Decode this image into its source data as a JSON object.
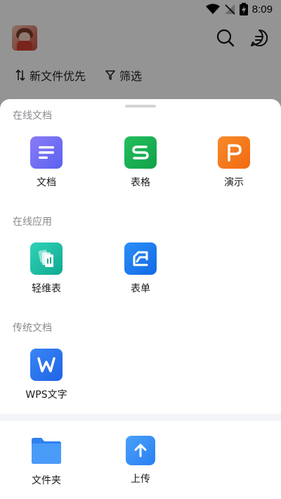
{
  "status_bar": {
    "time": "8:09"
  },
  "header": {
    "sort_label": "新文件优先",
    "filter_label": "筛选"
  },
  "sheet": {
    "sections": [
      {
        "title": "在线文档",
        "items": [
          {
            "label": "文档",
            "icon": "doc-icon",
            "color": "#6f6cf2"
          },
          {
            "label": "表格",
            "icon": "sheet-icon",
            "color": "#1aac4e"
          },
          {
            "label": "演示",
            "icon": "slides-icon",
            "color": "#f4791f"
          }
        ]
      },
      {
        "title": "在线应用",
        "items": [
          {
            "label": "轻维表",
            "icon": "lightsheet-icon",
            "color": "#1cb89f"
          },
          {
            "label": "表单",
            "icon": "form-icon",
            "color": "#1f7ff2"
          }
        ]
      },
      {
        "title": "传统文档",
        "items": [
          {
            "label": "WPS文字",
            "icon": "wps-writer-icon",
            "color": "#2a74f0"
          }
        ]
      }
    ],
    "actions": [
      {
        "label": "文件夹",
        "icon": "folder-icon",
        "color": "#3a8ef5"
      },
      {
        "label": "上传",
        "icon": "upload-icon",
        "color": "#3a8ef5"
      }
    ]
  }
}
